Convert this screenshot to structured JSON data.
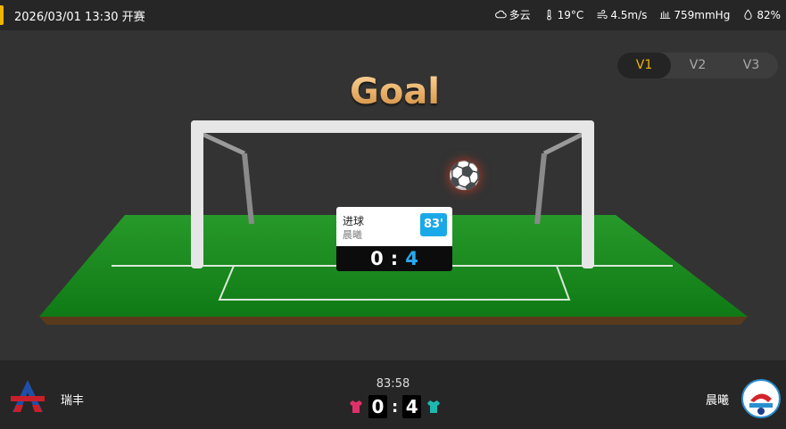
{
  "header": {
    "datetime": "2026/03/01 13:30 开赛",
    "weather": {
      "condition": "多云",
      "temperature": "19°C",
      "wind": "4.5m/s",
      "pressure": "759mmHg",
      "humidity": "82%",
      "icons": [
        "cloud-icon",
        "thermometer-icon",
        "wind-icon",
        "pressure-icon",
        "humidity-icon"
      ]
    }
  },
  "version_switch": {
    "options": [
      "V1",
      "V2",
      "V3"
    ],
    "active": "V1"
  },
  "animation": {
    "title": "Goal",
    "event_card": {
      "label": "进球",
      "team": "晨曦",
      "minute": "83'",
      "home_score": "0",
      "separator": ":",
      "away_score": "4"
    }
  },
  "match": {
    "clock": "83:58",
    "home": {
      "name": "瑞丰",
      "score": "0",
      "jersey_color": "#e0306a"
    },
    "away": {
      "name": "晨曦",
      "score": "4",
      "jersey_color": "#1fb8b0"
    },
    "separator": ":"
  },
  "colors": {
    "accent": "#f0b400",
    "minute_badge": "#1aa9e8",
    "away_score": "#29a8ee",
    "pitch": "#1e8a1e"
  }
}
